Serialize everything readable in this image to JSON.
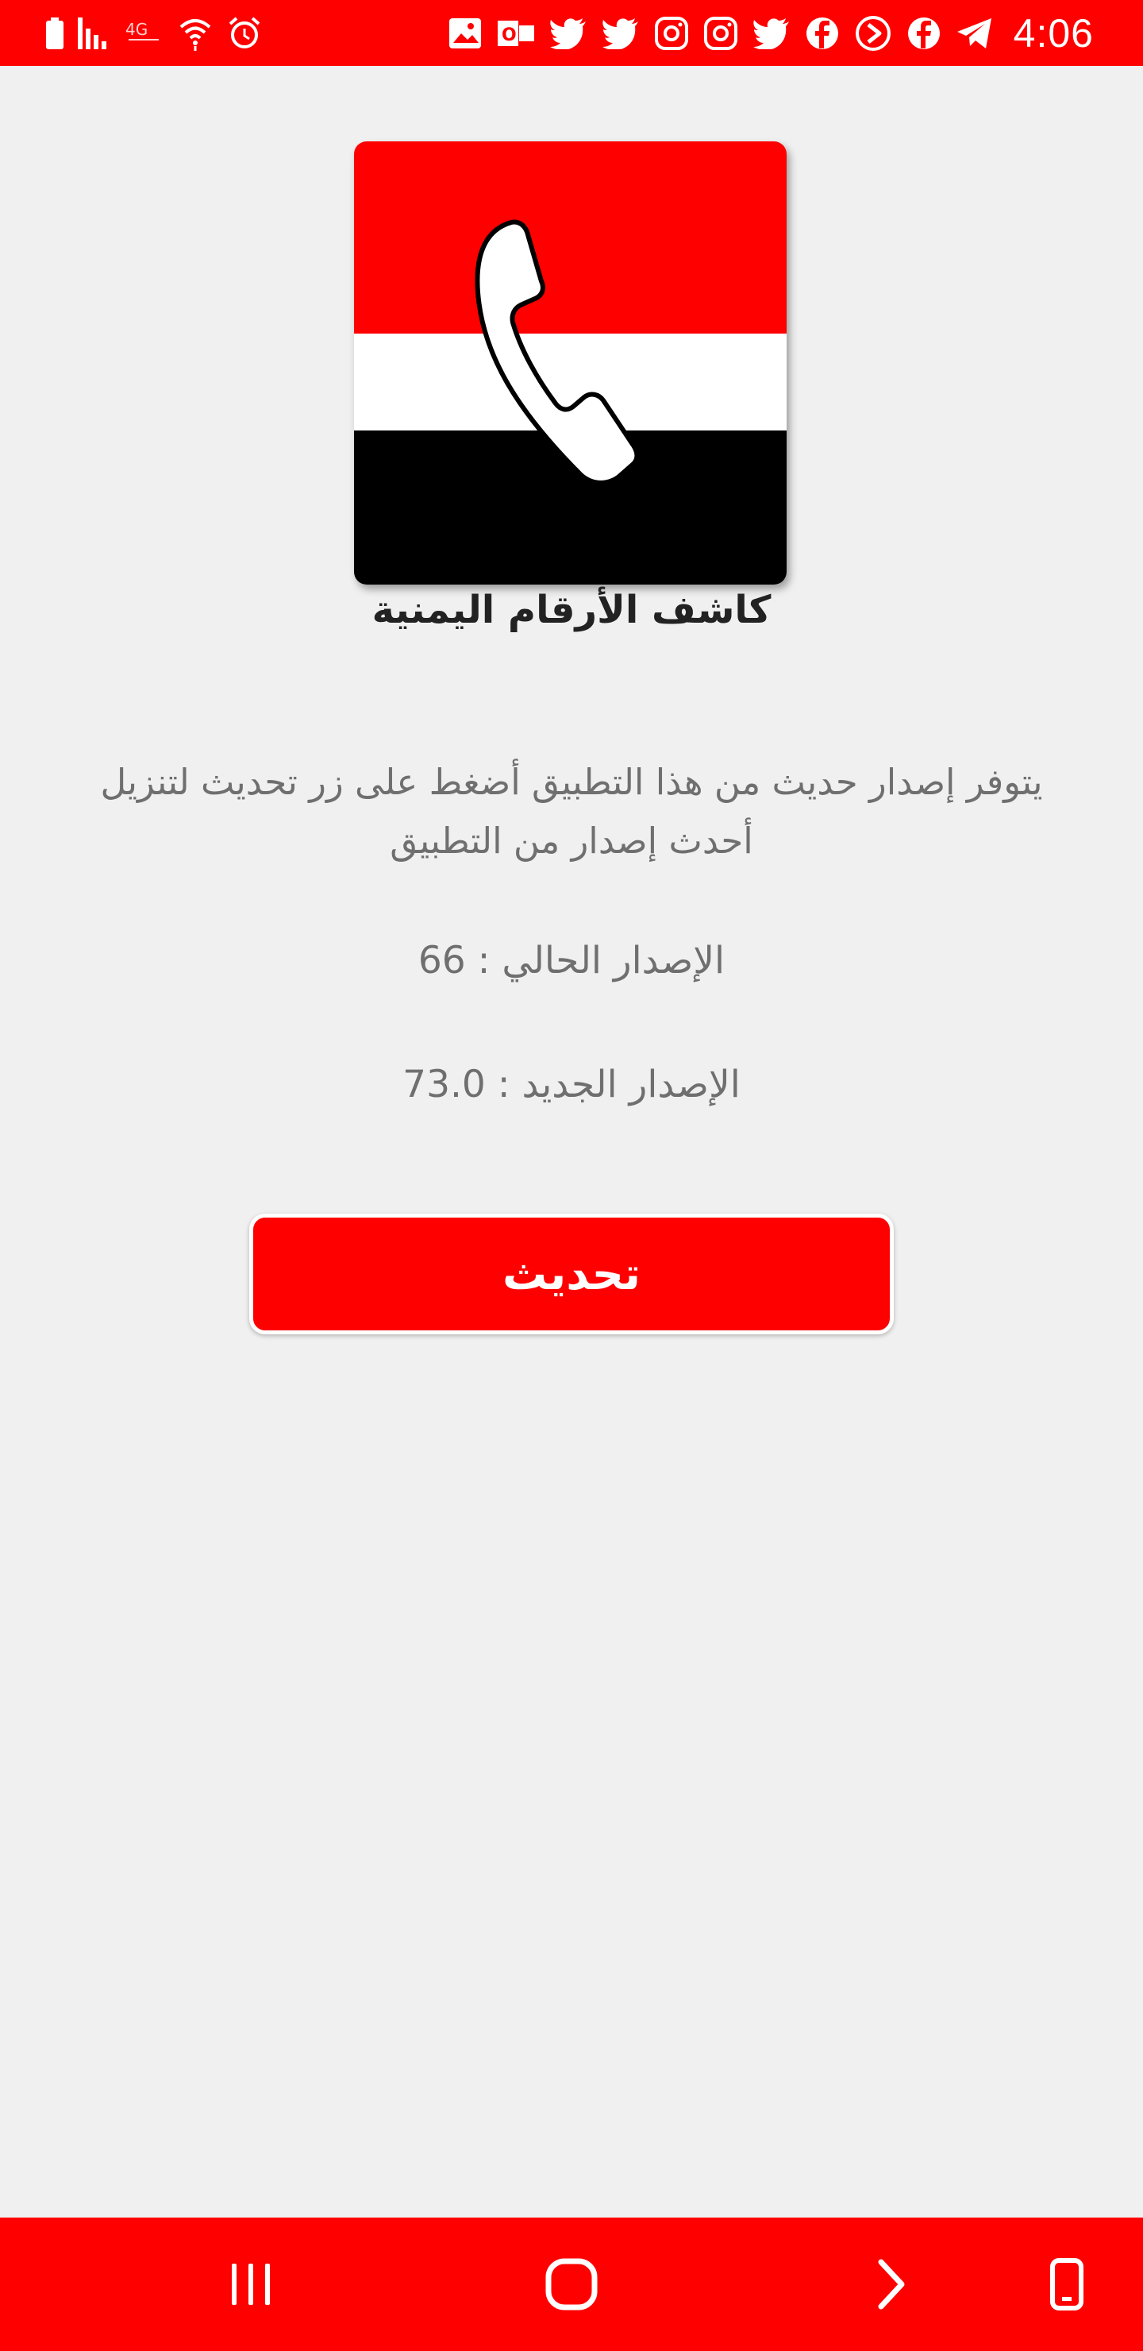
{
  "status_bar": {
    "time": "4:06",
    "background": "#ff0000",
    "left_icons": [
      "battery-icon",
      "signal-icon",
      "network-type-icon",
      "wifi-icon",
      "alarm-icon"
    ],
    "right_icons": [
      "gallery-icon",
      "outlook-icon",
      "twitter-icon",
      "twitter-icon",
      "instagram-icon",
      "instagram-icon",
      "twitter-icon",
      "facebook-icon",
      "play-icon",
      "facebook-icon",
      "telegram-icon"
    ]
  },
  "app": {
    "logo_caption": "كاشف الأرقام اليمنية"
  },
  "update": {
    "message": "يتوفر إصدار حديث من هذا التطبيق أضغط على زر تحديث لتنزيل أحدث إصدار من التطبيق",
    "current_version_label": "الإصدار الحالي : 66",
    "new_version_label": "الإصدار الجديد : 73.0",
    "button_label": "تحديث"
  },
  "nav_bar": {
    "buttons": [
      "recent-apps-icon",
      "home-icon",
      "back-icon",
      "keyboard-toggle-icon"
    ]
  },
  "colors": {
    "accent": "#ff0000",
    "background": "#f0f0f0",
    "text": "#6f6f6f"
  }
}
